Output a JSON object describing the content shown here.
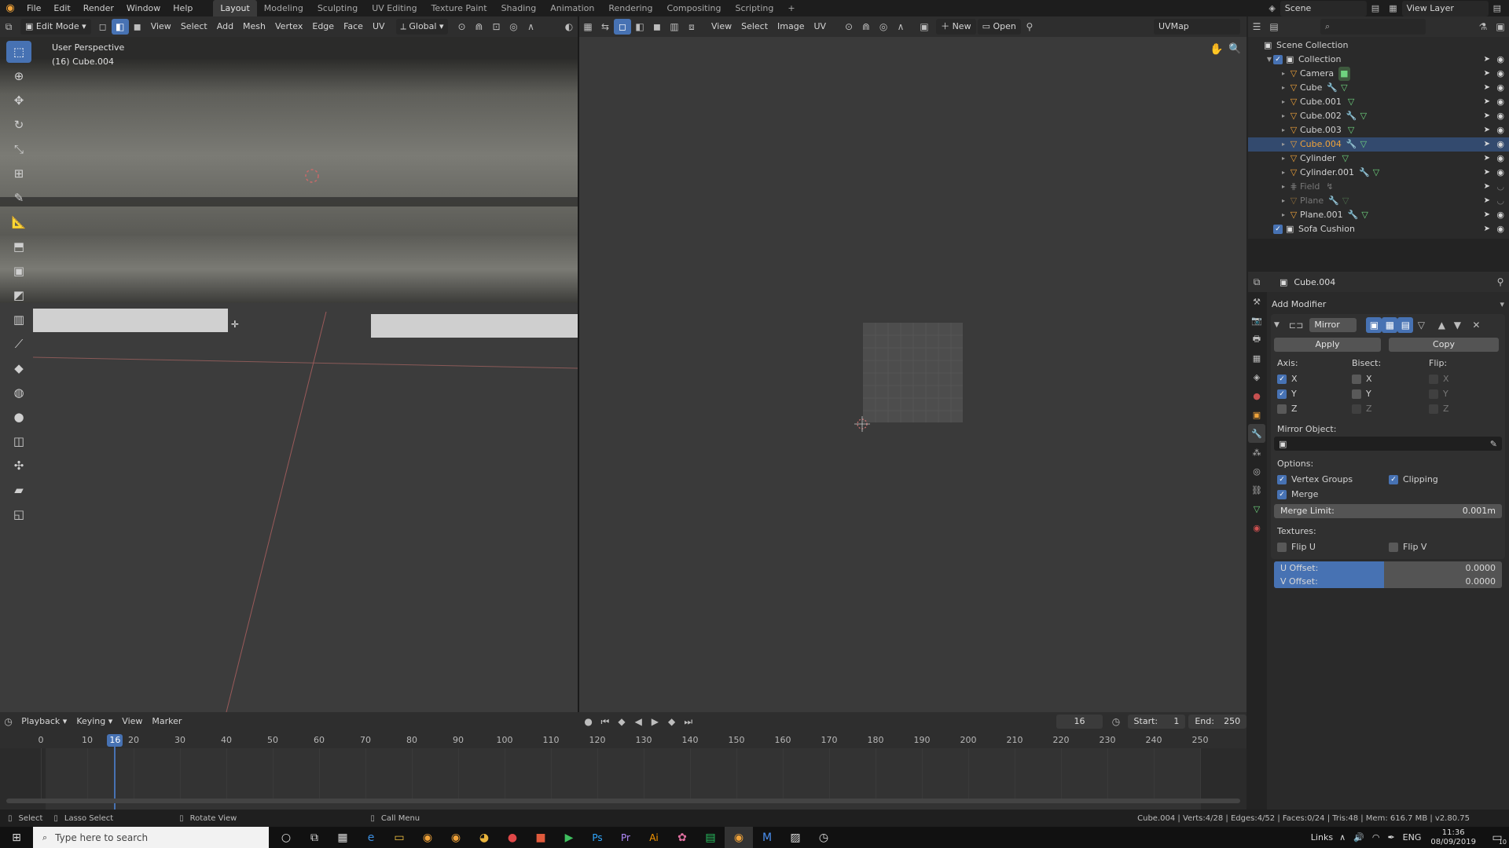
{
  "menu": {
    "items": [
      "File",
      "Edit",
      "Render",
      "Window",
      "Help"
    ],
    "workspaces": [
      "Layout",
      "Modeling",
      "Sculpting",
      "UV Editing",
      "Texture Paint",
      "Shading",
      "Animation",
      "Rendering",
      "Compositing",
      "Scripting"
    ],
    "active_workspace": "Layout",
    "add_tab": "+",
    "scene": "Scene",
    "view_layer": "View Layer"
  },
  "viewport_header": {
    "mode": "Edit Mode",
    "menus": [
      "View",
      "Select",
      "Add",
      "Mesh",
      "Vertex",
      "Edge",
      "Face",
      "UV"
    ],
    "transform_orientation": "Global"
  },
  "viewport": {
    "perspective": "User Perspective",
    "object_info": "(16) Cube.004"
  },
  "uv_header": {
    "menus": [
      "View",
      "Select",
      "Image",
      "UV"
    ],
    "new_label": "New",
    "open_label": "Open",
    "uv_map": "UVMap"
  },
  "outliner": {
    "root": "Scene Collection",
    "collection": "Collection",
    "objects": [
      {
        "name": "Camera",
        "dim": false,
        "active": false
      },
      {
        "name": "Cube",
        "dim": false,
        "active": false
      },
      {
        "name": "Cube.001",
        "dim": false,
        "active": false
      },
      {
        "name": "Cube.002",
        "dim": false,
        "active": false
      },
      {
        "name": "Cube.003",
        "dim": false,
        "active": false
      },
      {
        "name": "Cube.004",
        "dim": false,
        "active": true
      },
      {
        "name": "Cylinder",
        "dim": false,
        "active": false
      },
      {
        "name": "Cylinder.001",
        "dim": false,
        "active": false
      },
      {
        "name": "Field",
        "dim": true,
        "active": false
      },
      {
        "name": "Plane",
        "dim": true,
        "active": false
      },
      {
        "name": "Plane.001",
        "dim": false,
        "active": false
      }
    ],
    "other_collection": "Sofa Cushion"
  },
  "properties": {
    "object_name": "Cube.004",
    "add_modifier": "Add Modifier",
    "modifier_name": "Mirror",
    "apply": "Apply",
    "copy": "Copy",
    "axis_label": "Axis:",
    "bisect_label": "Bisect:",
    "flip_label": "Flip:",
    "axes": [
      "X",
      "Y",
      "Z"
    ],
    "mirror_object_label": "Mirror Object:",
    "options_label": "Options:",
    "vertex_groups": "Vertex Groups",
    "clipping": "Clipping",
    "merge": "Merge",
    "merge_limit_label": "Merge Limit:",
    "merge_limit_value": "0.001m",
    "textures_label": "Textures:",
    "flip_u": "Flip U",
    "flip_v": "Flip V",
    "u_offset_label": "U Offset:",
    "u_offset_value": "0.0000",
    "v_offset_label": "V Offset:",
    "v_offset_value": "0.0000"
  },
  "timeline": {
    "menus": [
      "Playback",
      "Keying",
      "View",
      "Marker"
    ],
    "current_frame": "16",
    "start_label": "Start:",
    "start_value": "1",
    "end_label": "End:",
    "end_value": "250",
    "ticks": [
      "0",
      "10",
      "20",
      "30",
      "40",
      "50",
      "60",
      "70",
      "80",
      "90",
      "100",
      "110",
      "120",
      "130",
      "140",
      "150",
      "160",
      "170",
      "180",
      "190",
      "200",
      "210",
      "220",
      "230",
      "240",
      "250"
    ]
  },
  "statusbar": {
    "select": "Select",
    "lasso": "Lasso Select",
    "rotate": "Rotate View",
    "call_menu": "Call Menu",
    "stats": "Cube.004 | Verts:4/28 | Edges:4/52 | Faces:0/24 | Tris:48 | Mem: 616.7 MB | v2.80.75"
  },
  "taskbar": {
    "search_placeholder": "Type here to search",
    "links": "Links",
    "language": "ENG",
    "time": "11:36",
    "date": "08/09/2019",
    "notifications": "10"
  }
}
